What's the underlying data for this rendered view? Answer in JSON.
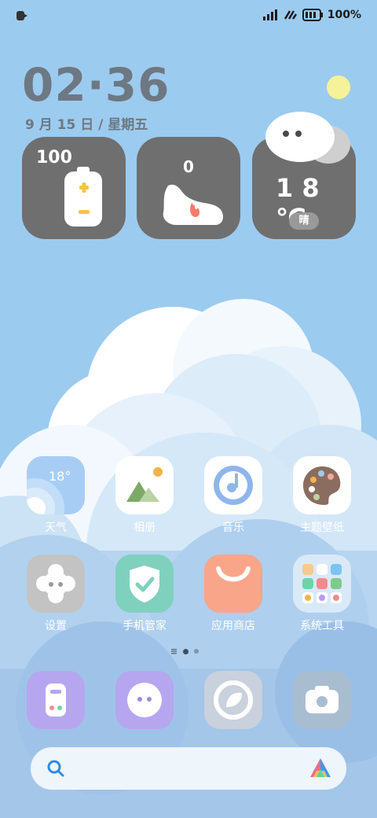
{
  "status_bar": {
    "battery_text": "100%"
  },
  "clock": {
    "time": "02·36",
    "date": "9 月 15 日  /  星期五"
  },
  "widgets": {
    "battery": {
      "value": "100"
    },
    "steps": {
      "value": "0"
    },
    "weather": {
      "temperature": "1 8 ℃",
      "condition": "晴"
    }
  },
  "apps": [
    {
      "label": "天气",
      "icon": "weather-icon",
      "badge": "18°"
    },
    {
      "label": "相册",
      "icon": "gallery-icon"
    },
    {
      "label": "音乐",
      "icon": "music-icon"
    },
    {
      "label": "主题壁纸",
      "icon": "themes-icon"
    },
    {
      "label": "设置",
      "icon": "settings-icon"
    },
    {
      "label": "手机管家",
      "icon": "security-icon"
    },
    {
      "label": "应用商店",
      "icon": "app-store-icon"
    },
    {
      "label": "系统工具",
      "icon": "tools-folder-icon"
    }
  ],
  "dock": [
    {
      "icon": "phone-icon"
    },
    {
      "icon": "messages-icon"
    },
    {
      "icon": "browser-icon"
    },
    {
      "icon": "camera-icon"
    }
  ],
  "page_indicator": {
    "current": 1,
    "total": 2
  },
  "colors": {
    "sky": "#9ccbf0",
    "widget_bg": "#6f6f6f",
    "clock_text": "#6e7882",
    "sun": "#f6f29a"
  }
}
